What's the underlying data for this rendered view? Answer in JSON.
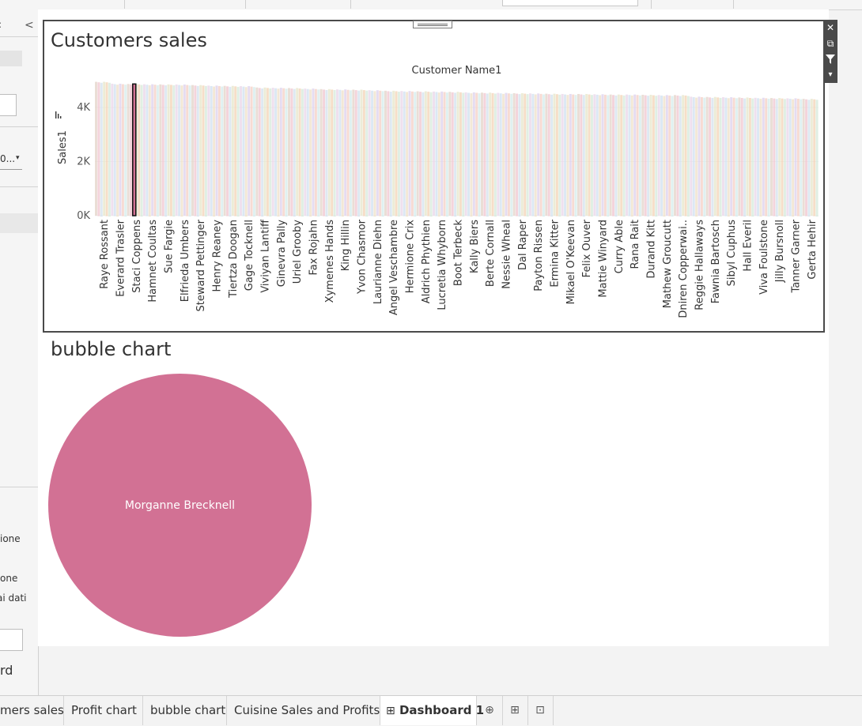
{
  "left_panel": {
    "collapse_glyph": "<",
    "top_char": ":",
    "dropdown_text": "0...",
    "dropdown_arrow": "▾",
    "fragment_1": "ione",
    "fragment_2": "one",
    "fragment_3": "ai dati",
    "fragment_4": "rd"
  },
  "zone_tools": {
    "close": "✕",
    "popout": "⧉",
    "filter": "funnel-icon",
    "menu": "▾"
  },
  "sales_zone": {
    "title": "Customers sales",
    "column_header": "Customer Name1",
    "axis_title": "Sales1"
  },
  "bubble_zone": {
    "title": "bubble chart",
    "bubble_label": "Morganne Brecknell",
    "bubble_color": "#d27194"
  },
  "chart_data": {
    "type": "bar",
    "title": "Customers sales",
    "xlabel": "Customer Name1",
    "ylabel": "Sales1",
    "ylim": [
      0,
      5000
    ],
    "yticks": [
      "0K",
      "2K",
      "4K"
    ],
    "ytick_values": [
      0,
      2000,
      4000
    ],
    "sort": "descending",
    "selected": "Staci Coppens",
    "categories": [
      "Raye Rossant",
      "Everard Trasler",
      "Staci Coppens",
      "Hamnet Coultas",
      "Sue Fargie",
      "Elfrieda Umbers",
      "Steward Pettinger",
      "Henry Reaney",
      "Tiertza Doogan",
      "Gage Tocknell",
      "Viviyan Lantiff",
      "Ginevra Pally",
      "Uriel Grooby",
      "Fax Rojahn",
      "Xymenes Hands",
      "King Hillin",
      "Yvon Chasmor",
      "Laurianne Diehn",
      "Angel Veschambre",
      "Hermione Crix",
      "Aldrich Phythien",
      "Lucretia Whyborn",
      "Boot Terbeck",
      "Kally Biers",
      "Berte Cornall",
      "Nessie Wheal",
      "Dal Raper",
      "Payton Rissen",
      "Ermina Kitter",
      "Mikael O'Keevan",
      "Felix Ouver",
      "Mattie Winyard",
      "Curry Able",
      "Rana Rait",
      "Durand Kitt",
      "Mathew Groucutt",
      "Dniren Copperwai..",
      "Reggie Hallaways",
      "Fawnia Bartosch",
      "Sibyl Cuphus",
      "Hall Everil",
      "Viva Foulstone",
      "Jilly Bursnoll",
      "Tanner Garner",
      "Gerta Hehir"
    ],
    "values": [
      4950,
      4880,
      4870,
      4860,
      4855,
      4850,
      4830,
      4810,
      4800,
      4790,
      4740,
      4730,
      4720,
      4700,
      4680,
      4670,
      4660,
      4640,
      4620,
      4610,
      4600,
      4590,
      4580,
      4560,
      4550,
      4540,
      4530,
      4520,
      4510,
      4500,
      4500,
      4490,
      4480,
      4480,
      4470,
      4460,
      4460,
      4400,
      4390,
      4380,
      4370,
      4360,
      4350,
      4340,
      4320
    ],
    "bar_colors": [
      "#e3d3c8",
      "#f0c6cf",
      "#d3e2ee",
      "#e6e6c9",
      "#f3d3b6",
      "#d6eadb",
      "#ead6e8",
      "#d0e0f0",
      "#efe0c8",
      "#dcd0ec",
      "#f4cfc4",
      "#d4ecec"
    ]
  },
  "tabs": [
    {
      "label": "mers sales",
      "active": false
    },
    {
      "label": "Profit chart",
      "active": false
    },
    {
      "label": "bubble chart",
      "active": false
    },
    {
      "label": "Cuisine Sales and Profits",
      "active": false
    },
    {
      "label": "Dashboard 1",
      "active": true,
      "icon": "⊞"
    }
  ],
  "tab_icons": {
    "new_worksheet": "⊕",
    "new_dashboard": "⊞",
    "new_story": "⊡"
  }
}
